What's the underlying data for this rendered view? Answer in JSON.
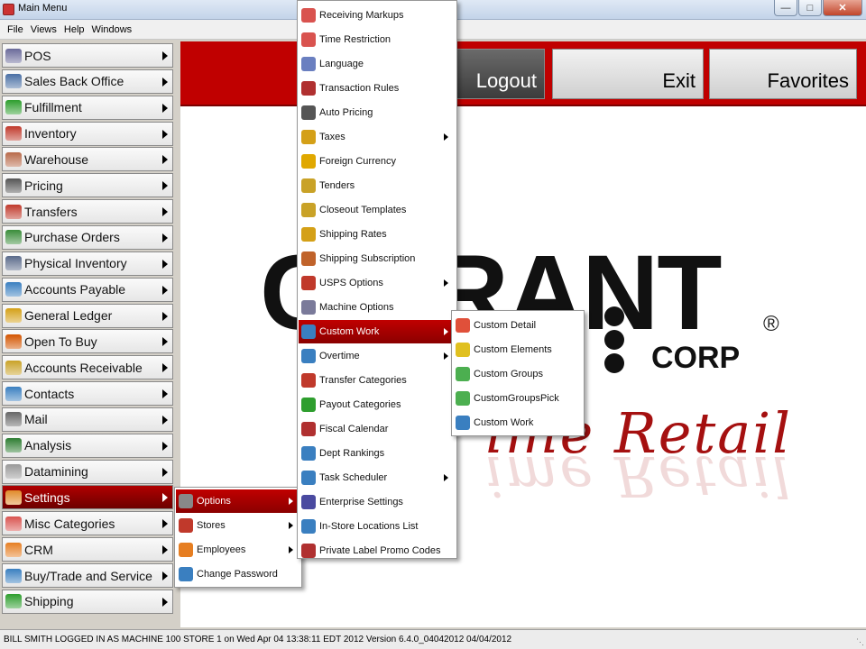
{
  "window": {
    "title": "Main Menu"
  },
  "menubar": [
    "File",
    "Views",
    "Help",
    "Windows"
  ],
  "sidebar": {
    "items": [
      {
        "label": "POS",
        "color": "#6a6a9a",
        "icon": "register-icon"
      },
      {
        "label": "Sales Back Office",
        "color": "#4a6fa5",
        "icon": "calculator-icon"
      },
      {
        "label": "Fulfillment",
        "color": "#2e9e2e",
        "icon": "boxes-icon"
      },
      {
        "label": "Inventory",
        "color": "#c0392b",
        "icon": "network-icon"
      },
      {
        "label": "Warehouse",
        "color": "#b8694a",
        "icon": "box-icon"
      },
      {
        "label": "Pricing",
        "color": "#555555",
        "icon": "tag-icon"
      },
      {
        "label": "Transfers",
        "color": "#c0392b",
        "icon": "truck-icon"
      },
      {
        "label": "Purchase Orders",
        "color": "#3a8d3a",
        "icon": "clipboard-icon"
      },
      {
        "label": "Physical Inventory",
        "color": "#5a6a8a",
        "icon": "scanner-icon"
      },
      {
        "label": "Accounts Payable",
        "color": "#3a7fc0",
        "icon": "calculator-icon"
      },
      {
        "label": "General Ledger",
        "color": "#d4a017",
        "icon": "ledger-icon"
      },
      {
        "label": "Open To Buy",
        "color": "#d35400",
        "icon": "hand-icon"
      },
      {
        "label": "Accounts Receivable",
        "color": "#c9a227",
        "icon": "money-bag-icon"
      },
      {
        "label": "Contacts",
        "color": "#3a7fc0",
        "icon": "rolodex-icon"
      },
      {
        "label": "Mail",
        "color": "#666666",
        "icon": "mail-icon"
      },
      {
        "label": "Analysis",
        "color": "#2e7d32",
        "icon": "bar-chart-icon"
      },
      {
        "label": "Datamining",
        "color": "#999999",
        "icon": "diamond-icon"
      },
      {
        "label": "Settings",
        "color": "#e08a2a",
        "icon": "tools-icon"
      },
      {
        "label": "Misc Categories",
        "color": "#d9534f",
        "icon": "star-icon"
      },
      {
        "label": "CRM",
        "color": "#e67e22",
        "icon": "people-icon"
      },
      {
        "label": "Buy/Trade and Service",
        "color": "#3a7fc0",
        "icon": "handshake-icon"
      },
      {
        "label": "Shipping",
        "color": "#2e9e2e",
        "icon": "package-icon"
      }
    ]
  },
  "toolbar": {
    "logout_label": "Logout",
    "exit_label": "Exit",
    "favorites_label": "Favorites"
  },
  "logo": {
    "main": "C  ERANT",
    "reg": "®",
    "corp": "CORP",
    "tagline": "ime Retail"
  },
  "settings_menu": {
    "items": [
      {
        "label": "Options",
        "icon": "gears-icon",
        "color": "#888888",
        "has_sub": true
      },
      {
        "label": "Stores",
        "icon": "store-icon",
        "color": "#c0392b",
        "has_sub": true
      },
      {
        "label": "Employees",
        "icon": "people-icon",
        "color": "#e67e22",
        "has_sub": true
      },
      {
        "label": "Change Password",
        "icon": "people-icon",
        "color": "#3a7fc0",
        "has_sub": false
      }
    ]
  },
  "options_menu": {
    "items": [
      {
        "label": "Receiving Markups",
        "icon": "clock-icon",
        "color": "#d9534f",
        "has_sub": false
      },
      {
        "label": "Time Restriction",
        "icon": "clock-icon",
        "color": "#d9534f",
        "has_sub": false
      },
      {
        "label": "Language",
        "icon": "speech-icon",
        "color": "#6a7fc0",
        "has_sub": false
      },
      {
        "label": "Transaction Rules",
        "icon": "book-icon",
        "color": "#b03030",
        "has_sub": false
      },
      {
        "label": "Auto Pricing",
        "icon": "tag-icon",
        "color": "#555555",
        "has_sub": false
      },
      {
        "label": "Taxes",
        "icon": "ledger-icon",
        "color": "#d4a017",
        "has_sub": true
      },
      {
        "label": "Foreign Currency",
        "icon": "coin-icon",
        "color": "#e0a800",
        "has_sub": false
      },
      {
        "label": "Tenders",
        "icon": "money-bag-icon",
        "color": "#c9a227",
        "has_sub": false
      },
      {
        "label": "Closeout Templates",
        "icon": "money-bag-icon",
        "color": "#c9a227",
        "has_sub": false
      },
      {
        "label": "Shipping Rates",
        "icon": "money-bag-icon",
        "color": "#d4a017",
        "has_sub": false
      },
      {
        "label": "Shipping Subscription",
        "icon": "pen-icon",
        "color": "#c0632b",
        "has_sub": false
      },
      {
        "label": "USPS Options",
        "icon": "flag-icon",
        "color": "#c0392b",
        "has_sub": true
      },
      {
        "label": "Machine Options",
        "icon": "checklist-icon",
        "color": "#7a7a9a",
        "has_sub": false
      },
      {
        "label": "Custom Work",
        "icon": "puzzle-icon",
        "color": "#3a7fc0",
        "has_sub": true
      },
      {
        "label": "Overtime",
        "icon": "clock-icon",
        "color": "#3a7fc0",
        "has_sub": true
      },
      {
        "label": "Transfer Categories",
        "icon": "truck-icon",
        "color": "#c0392b",
        "has_sub": false
      },
      {
        "label": "Payout Categories",
        "icon": "star-icon",
        "color": "#2e9e2e",
        "has_sub": false
      },
      {
        "label": "Fiscal Calendar",
        "icon": "calendar-icon",
        "color": "#b03030",
        "has_sub": false
      },
      {
        "label": "Dept Rankings",
        "icon": "ranking-icon",
        "color": "#3a7fc0",
        "has_sub": false
      },
      {
        "label": "Task Scheduler",
        "icon": "clock-icon",
        "color": "#3a7fc0",
        "has_sub": true
      },
      {
        "label": "Enterprise Settings",
        "icon": "list-icon",
        "color": "#4a4aa0",
        "has_sub": false
      },
      {
        "label": "In-Store Locations List",
        "icon": "umbrella-icon",
        "color": "#3a7fc0",
        "has_sub": false
      },
      {
        "label": "Private Label Promo Codes",
        "icon": "gear-icon",
        "color": "#b03030",
        "has_sub": false
      }
    ]
  },
  "custom_work_menu": {
    "items": [
      {
        "label": "Custom Detail",
        "icon": "puzzle-icon",
        "color": "#e0503a"
      },
      {
        "label": "Custom Elements",
        "icon": "puzzle-icon",
        "color": "#e0c020"
      },
      {
        "label": "Custom Groups",
        "icon": "puzzle-icon",
        "color": "#4caf50"
      },
      {
        "label": "CustomGroupsPick",
        "icon": "puzzle-icon",
        "color": "#4caf50"
      },
      {
        "label": "Custom Work",
        "icon": "puzzle-icon",
        "color": "#3a7fc0"
      }
    ]
  },
  "status": {
    "text": "BILL SMITH LOGGED IN AS MACHINE 100 STORE  1  on Wed Apr 04 13:38:11 EDT 2012    Version 6.4.0_04042012 04/04/2012"
  }
}
